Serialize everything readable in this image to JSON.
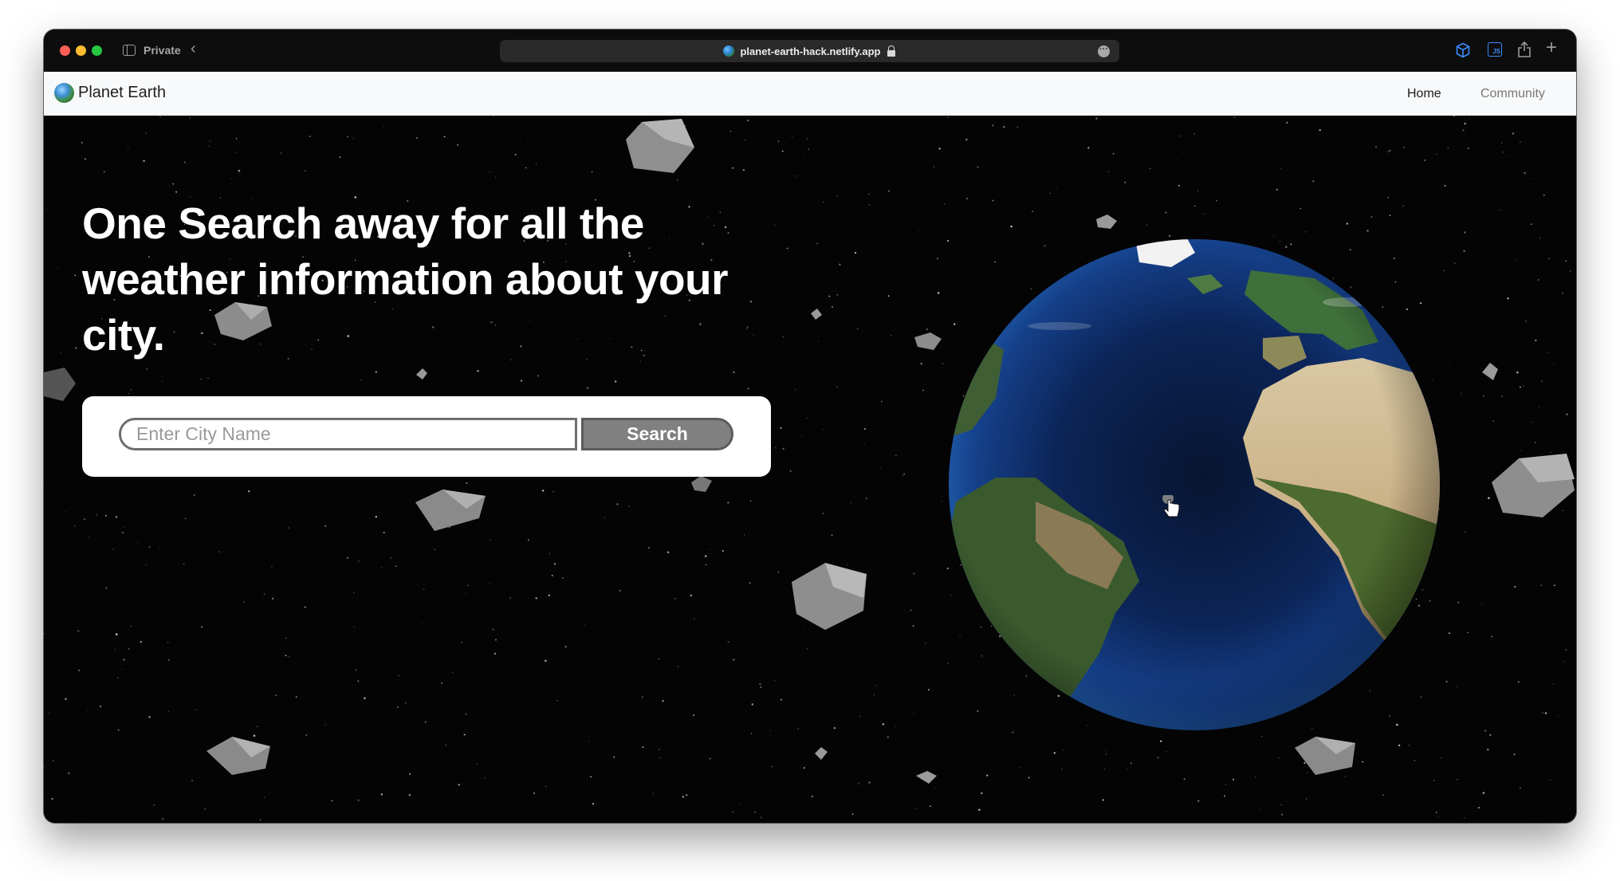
{
  "browser": {
    "mode_label": "Private",
    "url": "planet-earth-hack.netlify.app",
    "icons": [
      "sidebar-icon",
      "back-icon",
      "lock-icon",
      "more-icon",
      "cube-extension-icon",
      "js-extension-icon",
      "share-icon",
      "new-tab-icon"
    ]
  },
  "navbar": {
    "brand": "Planet Earth",
    "links": [
      {
        "label": "Home"
      },
      {
        "label": "Community"
      }
    ]
  },
  "hero": {
    "headline_lines": [
      "One Search away for all the",
      "weather information about your",
      "city."
    ],
    "search": {
      "placeholder": "Enter City Name",
      "value": "",
      "button_label": "Search"
    }
  },
  "colors": {
    "chrome": "#0d0d0d",
    "navbar_bg": "#f8f9fa",
    "space_bg": "#040405",
    "button_bg": "#808080",
    "traffic_red": "#ff5f57",
    "traffic_yellow": "#febc2e",
    "traffic_green": "#28c840"
  }
}
